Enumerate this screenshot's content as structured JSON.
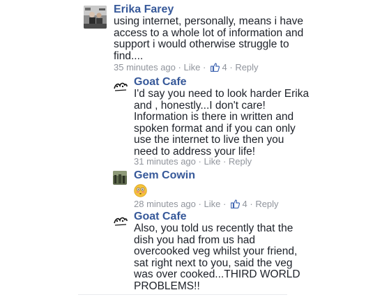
{
  "comments": [
    {
      "author": "Erika Farey",
      "text_lines": [
        "using internet, personally, means i have",
        "access to a whole lot of information and",
        "support i would otherwise struggle to",
        "find...."
      ],
      "time": "35 minutes ago",
      "like": "Like",
      "reactions": "4",
      "reply": "Reply",
      "avatar_icon": "profile-photo-icon"
    },
    {
      "author": "Goat Cafe",
      "text_lines": [
        "I'd say you need to look harder Erika",
        "and , honestly...I don't care!",
        "Information is there in written and",
        "spoken format and if you can only",
        "use the internet to live then you",
        "need to address your life!"
      ],
      "time": "31 minutes ago",
      "like": "Like",
      "reply": "Reply",
      "avatar_icon": "cafe-logo-icon"
    },
    {
      "author": "Gem Cowin",
      "emoji": "flushed-face-emoji",
      "time": "28 minutes ago",
      "like": "Like",
      "reactions": "4",
      "reply": "Reply",
      "avatar_icon": "profile-photo-icon"
    },
    {
      "author": "Goat Cafe",
      "text_lines": [
        "Also, you told us recently that the",
        "dish you had from us had",
        "overcooked veg whilst your friend,",
        "sat right next to you, said the veg",
        "was over cooked...THIRD WORLD",
        "PROBLEMS!!"
      ],
      "avatar_icon": "cafe-logo-icon"
    }
  ],
  "separator": " · ",
  "colors": {
    "author": "#365899",
    "meta": "#90949c",
    "text": "#1d2129",
    "like_blue": "#4267b2"
  }
}
